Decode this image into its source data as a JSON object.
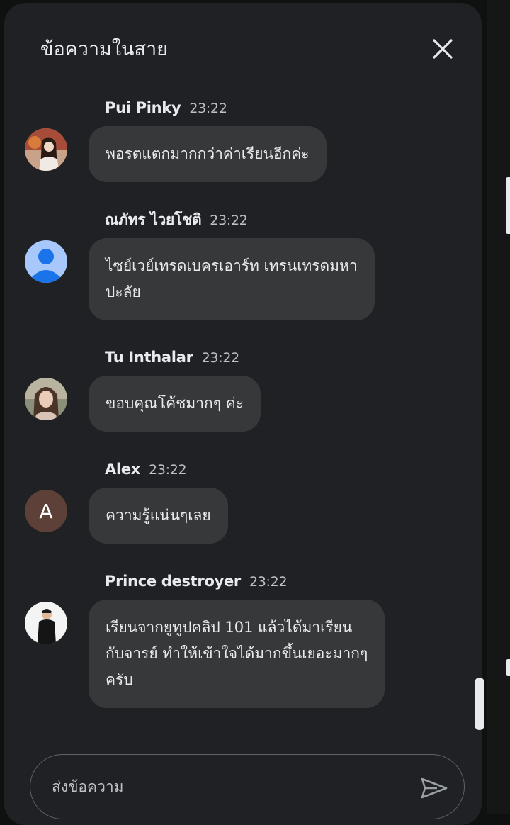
{
  "header": {
    "title": "ข้อความในสาย"
  },
  "messages": [
    {
      "sender": "Pui Pinky",
      "time": "23:22",
      "text": "พอรตแตกมากกว่าค่าเรียนอีกค่ะ",
      "avatar": "photo-avatar"
    },
    {
      "sender": "ณภัทร ไวยโชติ",
      "time": "23:22",
      "text": "ไซย์เวย์เทรดเบครเอาร์ท เทรนเทรดมหา\nปะลัย",
      "avatar": "default-person-avatar"
    },
    {
      "sender": "Tu Inthalar",
      "time": "23:22",
      "text": "ขอบคุณโค้ชมากๆ ค่ะ",
      "avatar": "photo-avatar"
    },
    {
      "sender": "Alex",
      "time": "23:22",
      "text": "ความรู้แน่นๆเลย",
      "avatar": "letter-avatar",
      "initial": "A"
    },
    {
      "sender": "Prince destroyer",
      "time": "23:22",
      "text": "เรียนจากยูทูปคลิป 101  แล้วได้มาเรียน\nกับจารย์ ทำให้เข้าใจได้มากขึ้นเยอะมากๆ\nครับ",
      "avatar": "photo-avatar"
    }
  ],
  "composer": {
    "placeholder": "ส่งข้อความ"
  },
  "icons": {
    "close": "close-icon",
    "send": "send-icon"
  },
  "colors": {
    "panel": "#202124",
    "bubble": "#36383a",
    "letter_avatar": "#5d4037"
  }
}
